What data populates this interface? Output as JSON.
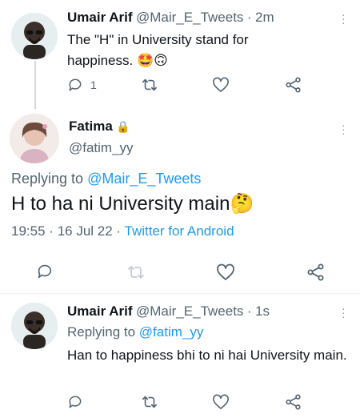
{
  "reply1": {
    "name": "Umair Arif",
    "handle": "@Mair_E_Tweets",
    "sep": "·",
    "time": "2m",
    "text": "The \"H\" in University stand for happiness.",
    "emojis": "🤩🙃",
    "reply_count": "1"
  },
  "main": {
    "name": "Fatima",
    "lock": "🔒",
    "handle": "@fatim_yy",
    "replying_prefix": "Replying to",
    "replying_handle": "@Mair_E_Tweets",
    "text": "H to ha ni University main",
    "emoji": "🤔",
    "time": "19:55",
    "date": "16 Jul 22",
    "sep": "·",
    "source": "Twitter for Android"
  },
  "reply2": {
    "name": "Umair Arif",
    "handle": "@Mair_E_Tweets",
    "sep": "·",
    "time": "1s",
    "replying_prefix": "Replying to",
    "replying_handle": "@fatim_yy",
    "text": "Han to happiness bhi to ni hai University main."
  },
  "icons": [
    "reply-icon",
    "retweet-icon",
    "like-icon",
    "share-icon",
    "more-icon",
    "lock-icon"
  ],
  "colors": {
    "link": "#1d9bf0",
    "muted": "#536471",
    "text": "#0f1419"
  }
}
